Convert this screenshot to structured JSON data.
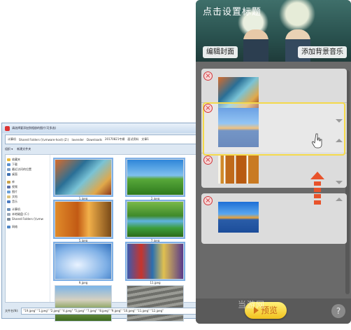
{
  "dialog": {
    "title": "请选择要添加到相册的图片(可多选)",
    "address": [
      "计算机",
      "Shared Folders (\\\\vmware-host) (Z:)",
      "lavender",
      "Downloads",
      "20170821专辑",
      "面试资料",
      "文章1"
    ],
    "toolbar": [
      "组织 ▾",
      "新建文件夹"
    ],
    "nav": [
      "收藏夹",
      "下载",
      "最近访问的位置",
      "桌面",
      "库",
      "视频",
      "图片",
      "文档",
      "音乐",
      "计算机",
      "本地磁盘 (C:)",
      "Shared Folders (\\\\vmw",
      "网络"
    ],
    "files": [
      {
        "name": "1.jpeg",
        "paint": "art"
      },
      {
        "name": "2.jpeg",
        "paint": "field"
      },
      {
        "name": "5.jpeg",
        "paint": "forest"
      },
      {
        "name": "7.jpeg",
        "paint": "river"
      },
      {
        "name": "9.jpeg",
        "paint": "snow"
      },
      {
        "name": "11.jpeg",
        "paint": "market"
      },
      {
        "name": "",
        "paint": "crowd"
      },
      {
        "name": "",
        "paint": "rows"
      }
    ],
    "filename_label": "文件名(N):",
    "filename_value": "\"19.jpeg\" \"1.jpeg\" \"2.jpeg\" \"4.jpeg\" \"5.jpeg\" \"7.jpeg\" \"8.jpeg\" \"9.jpeg\" \"10.jpeg\" \"11.jpeg\" \"12.jpeg\""
  },
  "panel": {
    "title": "点击设置标题",
    "edit_cover_label": "编辑封面",
    "add_music_label": "添加背景音乐",
    "preview_label": "预览",
    "help_label": "?",
    "watermark": "当游网"
  },
  "colors": {
    "highlight": "#f4d94a",
    "close": "#d2373b",
    "arrow": "#e8532b",
    "preview": "#f2c21e"
  }
}
